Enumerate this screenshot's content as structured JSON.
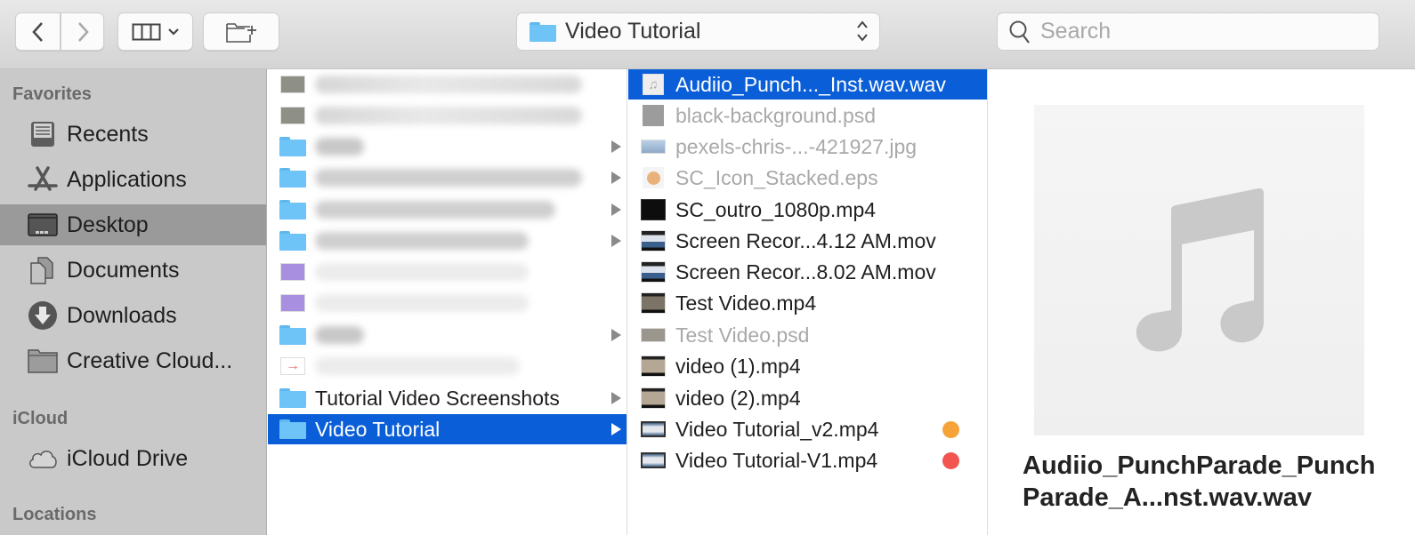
{
  "toolbar": {
    "back_icon": "chevron-left-icon",
    "forward_icon": "chevron-right-icon",
    "view_icon": "column-view-icon",
    "new_folder_icon": "new-folder-icon",
    "path_popup_label": "Video Tutorial",
    "search_placeholder": "Search",
    "search_value": ""
  },
  "sidebar": {
    "sections": [
      {
        "heading": "Favorites",
        "items": [
          {
            "label": "Recents",
            "icon": "recents-icon",
            "selected": false
          },
          {
            "label": "Applications",
            "icon": "applications-icon",
            "selected": false
          },
          {
            "label": "Desktop",
            "icon": "desktop-icon",
            "selected": true
          },
          {
            "label": "Documents",
            "icon": "documents-icon",
            "selected": false
          },
          {
            "label": "Downloads",
            "icon": "downloads-icon",
            "selected": false
          },
          {
            "label": "Creative Cloud...",
            "icon": "folder-icon",
            "selected": false
          }
        ]
      },
      {
        "heading": "iCloud",
        "items": [
          {
            "label": "iCloud Drive",
            "icon": "cloud-icon",
            "selected": false
          }
        ]
      },
      {
        "heading": "Locations",
        "items": []
      }
    ]
  },
  "column1": {
    "items": [
      {
        "name": "",
        "blurred": true,
        "kind": "image-thumb",
        "has_children": false
      },
      {
        "name": "",
        "blurred": true,
        "kind": "image-thumb",
        "has_children": false
      },
      {
        "name": "",
        "blurred": true,
        "kind": "folder",
        "has_children": true
      },
      {
        "name": "",
        "blurred": true,
        "kind": "folder",
        "has_children": true
      },
      {
        "name": "",
        "blurred": true,
        "kind": "folder",
        "has_children": true
      },
      {
        "name": "",
        "blurred": true,
        "kind": "folder",
        "has_children": true
      },
      {
        "name": "",
        "blurred": true,
        "kind": "purple-thumb",
        "has_children": false
      },
      {
        "name": "",
        "blurred": true,
        "kind": "purple-thumb",
        "has_children": false
      },
      {
        "name": "",
        "blurred": true,
        "kind": "folder",
        "has_children": true
      },
      {
        "name": "",
        "blurred": true,
        "kind": "arrow-thumb",
        "has_children": false
      },
      {
        "name": "Tutorial Video Screenshots",
        "blurred": false,
        "kind": "folder",
        "has_children": true
      },
      {
        "name": "Video Tutorial",
        "blurred": false,
        "kind": "folder",
        "has_children": true,
        "selected": true
      }
    ]
  },
  "column2": {
    "items": [
      {
        "name": "Audiio_Punch..._Inst.wav.wav",
        "kind": "audio",
        "selected": true,
        "dimmed": false
      },
      {
        "name": "black-background.psd",
        "kind": "psd-gray",
        "dimmed": true
      },
      {
        "name": "pexels-chris-...-421927.jpg",
        "kind": "jpg",
        "dimmed": true
      },
      {
        "name": "SC_Icon_Stacked.eps",
        "kind": "eps",
        "dimmed": true
      },
      {
        "name": "SC_outro_1080p.mp4",
        "kind": "video-black",
        "dimmed": false
      },
      {
        "name": "Screen Recor...4.12 AM.mov",
        "kind": "video-screen",
        "dimmed": false
      },
      {
        "name": "Screen Recor...8.02 AM.mov",
        "kind": "video-screen",
        "dimmed": false
      },
      {
        "name": "Test Video.mp4",
        "kind": "video",
        "dimmed": false
      },
      {
        "name": "Test Video.psd",
        "kind": "psd",
        "dimmed": true
      },
      {
        "name": "video (1).mp4",
        "kind": "video",
        "dimmed": false
      },
      {
        "name": "video (2).mp4",
        "kind": "video",
        "dimmed": false
      },
      {
        "name": "Video Tutorial_v2.mp4",
        "kind": "video-tut",
        "dimmed": false,
        "tag": "orange",
        "tag_color": "#f6a33a"
      },
      {
        "name": "Video Tutorial-V1.mp4",
        "kind": "video-tut",
        "dimmed": false,
        "tag": "red",
        "tag_color": "#f25450"
      }
    ]
  },
  "preview": {
    "icon": "music-note-icon",
    "filename": "Audiio_PunchParade_PunchParade_A...nst.wav.wav"
  },
  "colors": {
    "selection": "#0a5fd8",
    "sidebar_bg": "#c9c9c9",
    "sidebar_selected": "#9a9a9a",
    "folder_blue": "#6ec3f7"
  }
}
